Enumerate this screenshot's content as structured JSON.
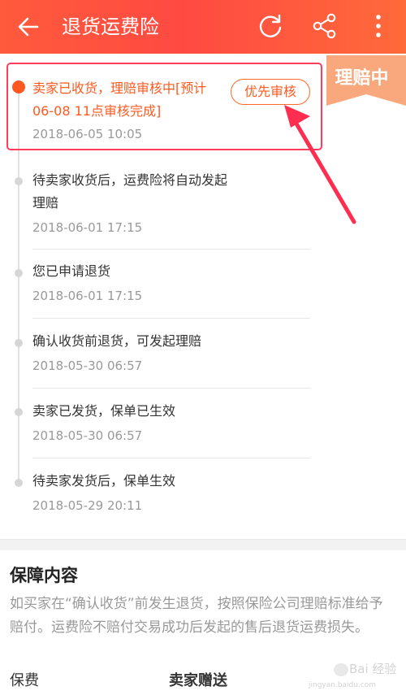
{
  "header": {
    "title": "退货运费险",
    "back_icon": "arrow-left-icon",
    "refresh_icon": "refresh-icon",
    "share_icon": "share-icon",
    "more_icon": "more-vertical-icon"
  },
  "status_badge": {
    "label": "理赔中",
    "color": "#f8a87c"
  },
  "priority_button": {
    "label": "优先审核"
  },
  "timeline": [
    {
      "text": "卖家已收货，理赔审核中[预计06-08 11点审核完成]",
      "time": "2018-06-05 10:05",
      "active": true
    },
    {
      "text": "待卖家收货后，运费险将自动发起理赔",
      "time": "2018-06-01 17:15"
    },
    {
      "text": "您已申请退货",
      "time": "2018-06-01 17:15"
    },
    {
      "text": "确认收货前退货，可发起理赔",
      "time": "2018-05-30 06:57"
    },
    {
      "text": "卖家已发货，保单已生效",
      "time": "2018-05-30 06:57"
    },
    {
      "text": "待卖家发货后，保单生效",
      "time": "2018-05-29 20:11"
    }
  ],
  "coverage": {
    "title": "保障内容",
    "description": "如买家在“确认收货”前发生退货，按照保险公司理赔标准给予赔付。运费险不赔付交易成功后发起的售后退货运费损失。",
    "fee_label": "保费",
    "fee_value": "卖家赠送"
  },
  "watermark": {
    "text": "Bai 经验",
    "sub": "jingyan.baidu.com"
  },
  "colors": {
    "accent": "#ff5a1f",
    "header": "#ff4a42",
    "annotation": "#ff3d5e"
  }
}
